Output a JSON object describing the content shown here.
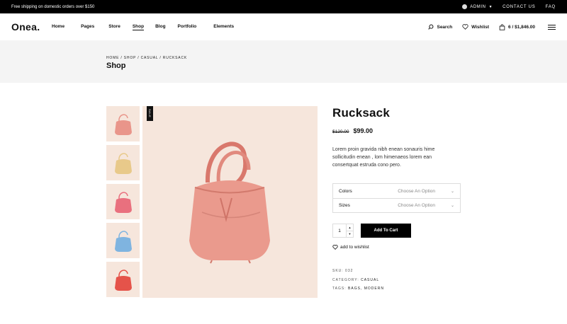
{
  "topbar": {
    "promo": "Free shipping on domestic orders over $150",
    "admin": "ADMIN",
    "contact": "CONTACT US",
    "faq": "FAQ"
  },
  "header": {
    "logo": "Onea.",
    "nav": [
      "Home",
      "Pages",
      "Store",
      "Shop",
      "Blog",
      "Portfolio",
      "Elements"
    ],
    "active_nav": "Shop",
    "search": "Search",
    "wishlist": "Wishlist",
    "cart": "6 / $1,846.00"
  },
  "pagehead": {
    "breadcrumb": "HOME  /  SHOP  /  CASUAL  /  RUCKSACK",
    "title": "Shop"
  },
  "gallery": {
    "sale_badge": "SALE",
    "thumb_colors": [
      "#e9958a",
      "#e8c98a",
      "#e9707e",
      "#7fb4e0",
      "#e5534a"
    ],
    "main_color": "#e9958a"
  },
  "product": {
    "title": "Rucksack",
    "old_price": "$120.00",
    "price": "$99.00",
    "description": "Lorem proin gravida nibh enean sonauris hime sollicitudin enean , lom himenaeos lorem ean consertquat estruda cono pero.",
    "options": [
      {
        "label": "Colors",
        "placeholder": "Choose An Option"
      },
      {
        "label": "Sizes",
        "placeholder": "Choose An Option"
      }
    ],
    "quantity": "1",
    "add_to_cart": "Add To Cart",
    "add_wishlist": "add to wishlist",
    "sku": "SKU:  032",
    "category_label": "CATEGORY: ",
    "category": "CASUAL",
    "tags_label": "TAGS: ",
    "tags": "BAGS, MODERN"
  }
}
